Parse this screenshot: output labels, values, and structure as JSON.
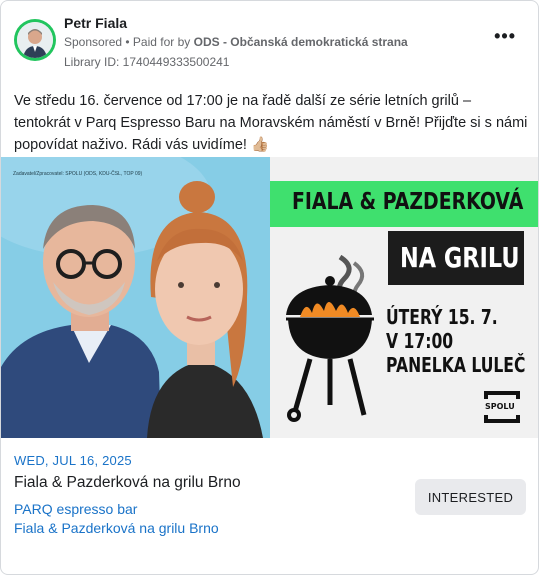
{
  "post": {
    "page_name": "Petr Fiala",
    "sponsored_label": "Sponsored",
    "paid_for_prefix": " • Paid for by ",
    "paid_for_org": "ODS - Občanská demokratická strana",
    "library_id": "Library ID: 1740449333500241",
    "text": "Ve středu 16. července od 17:00 je na řadě další ze série letních grilů – tentokrát v Parq Espresso Baru na Moravském náměstí v Brně! Přijďte si s námi popovídat naživo. Rádi vás uvidíme! 👍🏼",
    "more_icon": "more-horizontal-icon"
  },
  "media": {
    "disclaimer": "Zadavatel/Zpracovatel: SPOLU (ODS, KDU-ČSL, TOP 09)",
    "poster_title": "FIALA & PAZDERKOVÁ",
    "poster_subtitle": "NA GRILU",
    "poster_date": "ÚTERÝ 15. 7.",
    "poster_time": "V 17:00",
    "poster_place": "PANELKA LULEČ",
    "logo_text": "SPOLU",
    "green": "#3fe06e"
  },
  "event": {
    "date": "WED, JUL 16, 2025",
    "title": "Fiala & Pazderková na grilu Brno",
    "place": "PARQ espresso bar",
    "sub": "Fiala & Pazderková na grilu Brno",
    "button": "INTERESTED"
  },
  "colors": {
    "link_blue": "#1a73c8",
    "avatar_ring": "#22c55e"
  }
}
